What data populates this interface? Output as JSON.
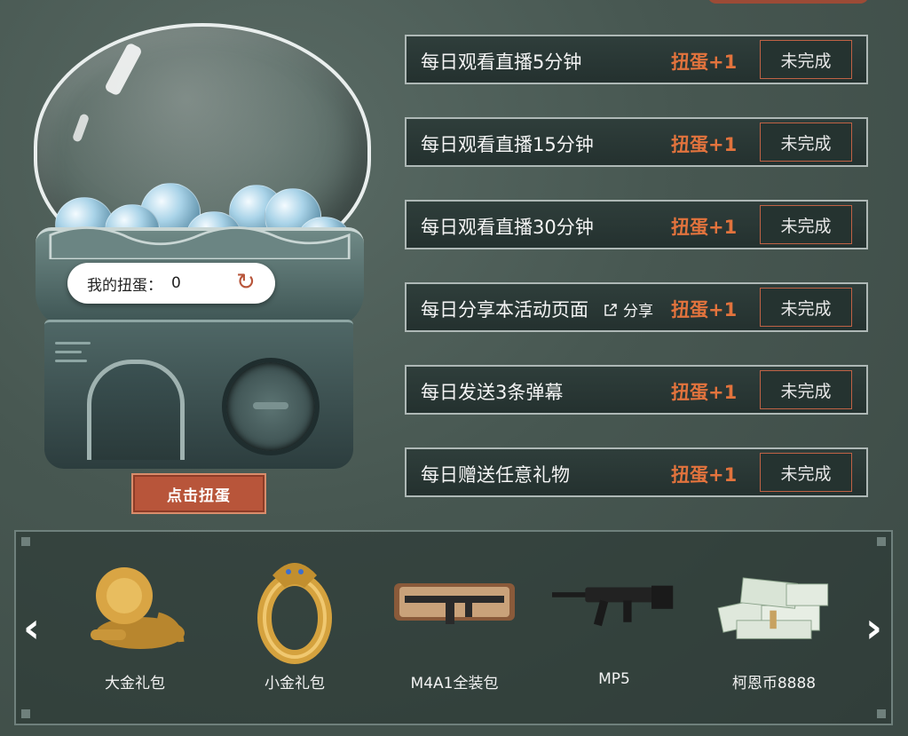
{
  "machine": {
    "counter_label": "我的扭蛋：",
    "counter_value": "0",
    "spin_button": "点击扭蛋"
  },
  "tasks": [
    {
      "title": "每日观看直播5分钟",
      "reward": "扭蛋+1",
      "status": "未完成",
      "share": ""
    },
    {
      "title": "每日观看直播15分钟",
      "reward": "扭蛋+1",
      "status": "未完成",
      "share": ""
    },
    {
      "title": "每日观看直播30分钟",
      "reward": "扭蛋+1",
      "status": "未完成",
      "share": ""
    },
    {
      "title": "每日分享本活动页面",
      "reward": "扭蛋+1",
      "status": "未完成",
      "share": "分享"
    },
    {
      "title": "每日发送3条弹幕",
      "reward": "扭蛋+1",
      "status": "未完成",
      "share": ""
    },
    {
      "title": "每日赠送任意礼物",
      "reward": "扭蛋+1",
      "status": "未完成",
      "share": ""
    }
  ],
  "prizes": [
    {
      "name": "大金礼包",
      "icon": "gold-lion-icon"
    },
    {
      "name": "小金礼包",
      "icon": "gold-bracelet-icon"
    },
    {
      "name": "M4A1全装包",
      "icon": "rifle-case-icon"
    },
    {
      "name": "MP5",
      "icon": "smg-icon"
    },
    {
      "name": "柯恩币8888",
      "icon": "money-stack-icon"
    }
  ],
  "colors": {
    "accent": "#e2733d",
    "button": "#b8553a",
    "panel": "#2f3e3b"
  }
}
